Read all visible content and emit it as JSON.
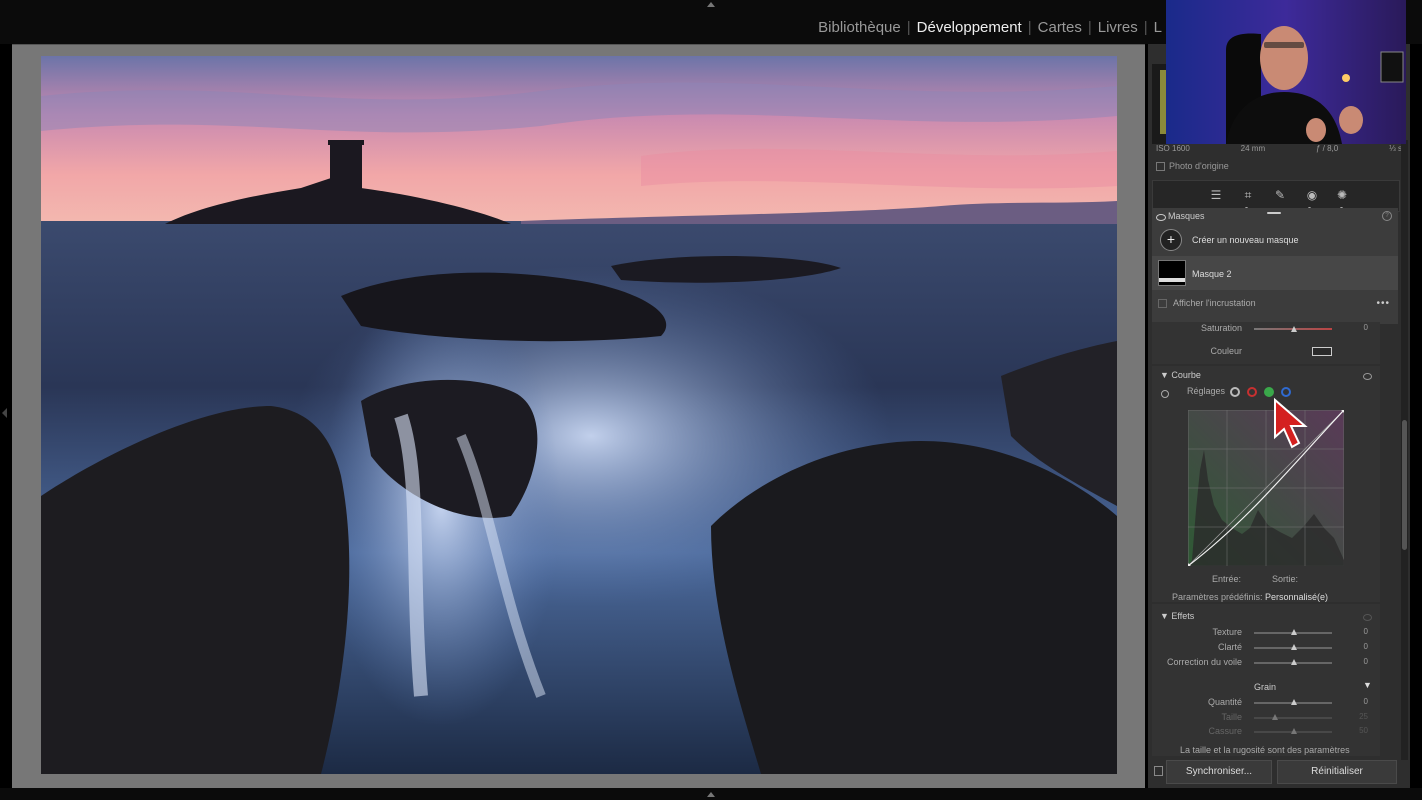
{
  "modules": {
    "items": [
      "Bibliothèque",
      "Développement",
      "Cartes",
      "Livres",
      "L"
    ],
    "active": "Développement"
  },
  "info": {
    "iso": "ISO 1600",
    "focal": "24 mm",
    "aperture": "ƒ / 8,0",
    "shutter": "⅓ s",
    "original_photo": "Photo d'origine"
  },
  "tool_icons": [
    "sliders-icon",
    "crop-icon",
    "healing-icon",
    "red-eye-icon",
    "masking-icon"
  ],
  "masks": {
    "title": "Masques",
    "create": "Créer un nouveau masque",
    "mask_name": "Masque 2",
    "overlay": "Afficher l'incrustation",
    "more": "•••"
  },
  "color_panel": {
    "saturation_label": "Saturation",
    "saturation_value": "0",
    "color_label": "Couleur"
  },
  "curve": {
    "title": "Courbe",
    "settings_label": "Réglages",
    "input_label": "Entrée:",
    "output_label": "Sortie:",
    "presets_label": "Paramètres prédéfinis:",
    "presets_value": "Personnalisé(e)"
  },
  "effects": {
    "title": "Effets",
    "texture_label": "Texture",
    "texture_value": "0",
    "clarity_label": "Clarté",
    "clarity_value": "0",
    "dehaze_label": "Correction du voile",
    "dehaze_value": "0",
    "grain_label": "Grain",
    "amount_label": "Quantité",
    "amount_value": "0",
    "size_label": "Taille",
    "size_value": "25",
    "roughness_label": "Cassure",
    "roughness_value": "50",
    "note": "La taille et la rugosité sont des paramètres"
  },
  "buttons": {
    "sync": "Synchroniser...",
    "reset": "Réinitialiser"
  },
  "colors": {
    "accent_red": "#d42020",
    "curve_green": "#3aa84a",
    "channel_red": "#c83030",
    "channel_blue": "#2f6ad0"
  }
}
